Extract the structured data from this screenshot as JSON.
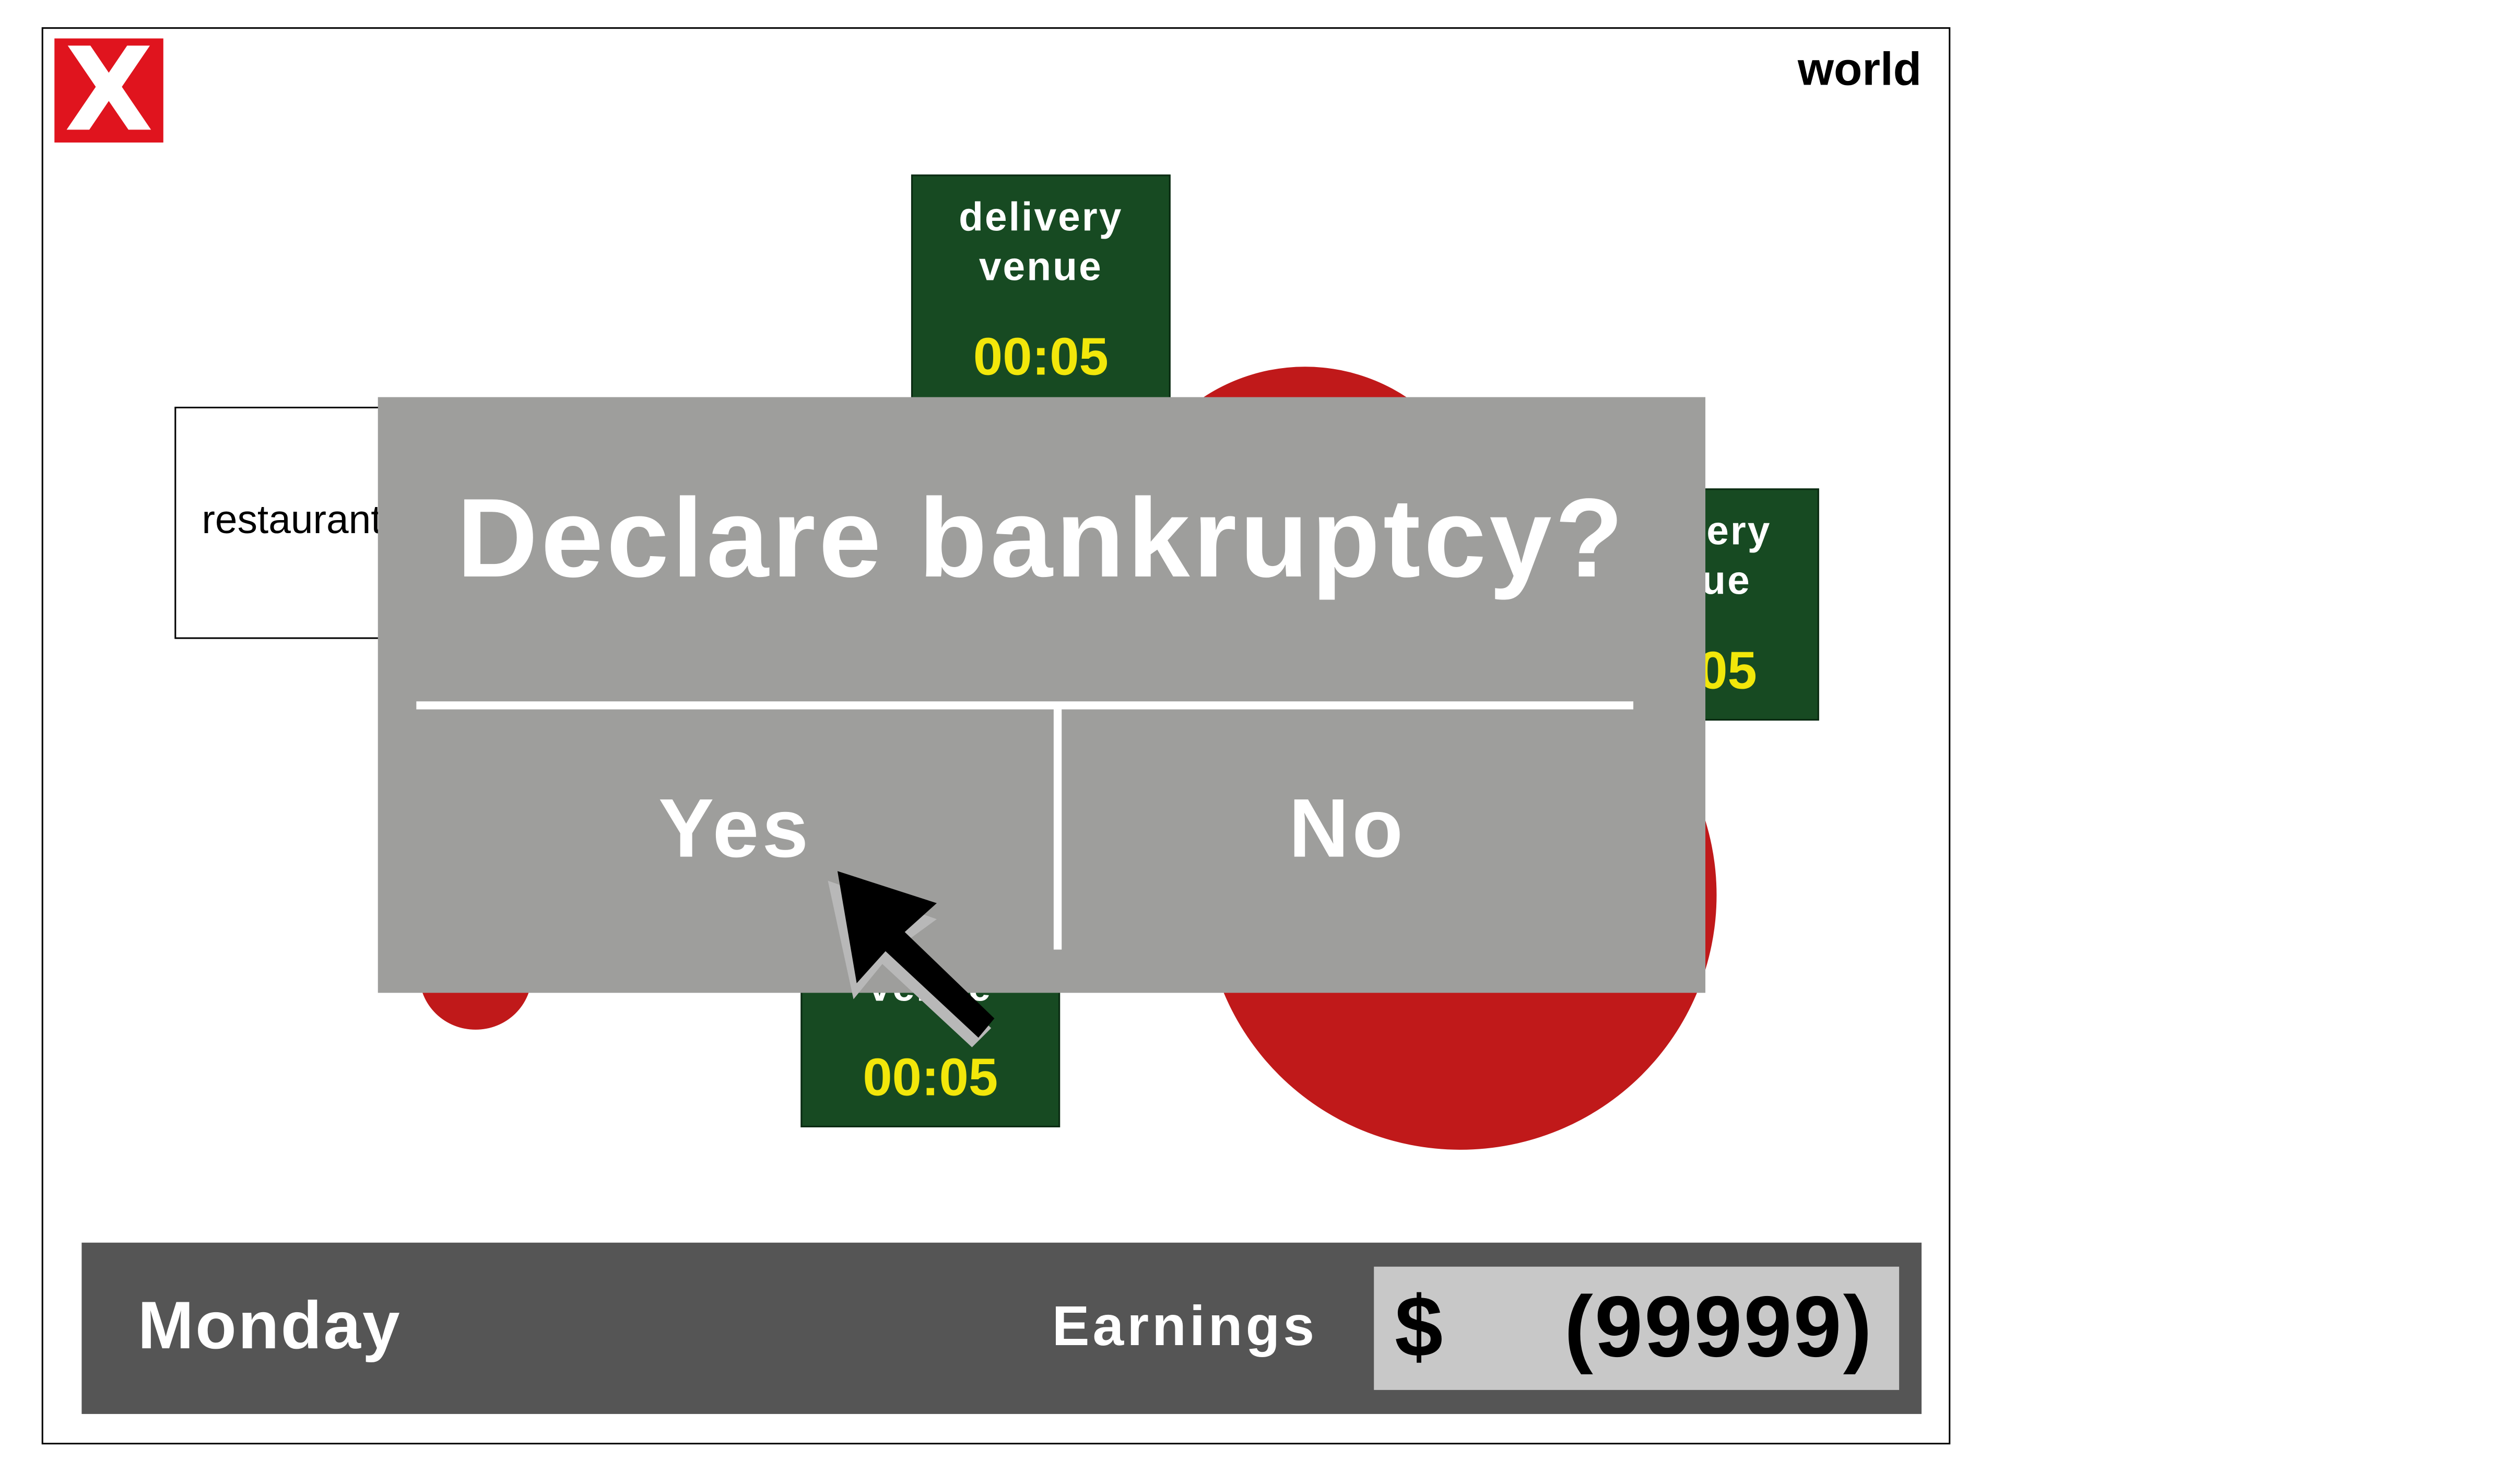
{
  "window": {
    "close_label": "X",
    "scene_label": "world"
  },
  "scene": {
    "restaurant_label": "restaurant",
    "venues": [
      {
        "name_line1": "delivery",
        "name_line2": "venue",
        "timer": "00:05"
      },
      {
        "name_line1": "delivery",
        "name_line2": "venue",
        "timer": "00:05"
      },
      {
        "name_line1": "delivery",
        "name_line2": "venue",
        "timer": "00:05"
      }
    ],
    "colors": {
      "venue_bg": "#174a22",
      "timer_text": "#f2e70a",
      "circle": "#c0191a",
      "close_bg": "#e0141e"
    }
  },
  "dialog": {
    "title": "Declare bankruptcy?",
    "yes_label": "Yes",
    "no_label": "No"
  },
  "status": {
    "day": "Monday",
    "earnings_label": "Earnings",
    "currency_symbol": "$",
    "earnings_value": "(99999)"
  },
  "cursor": {
    "icon": "arrow-pointer-icon"
  }
}
